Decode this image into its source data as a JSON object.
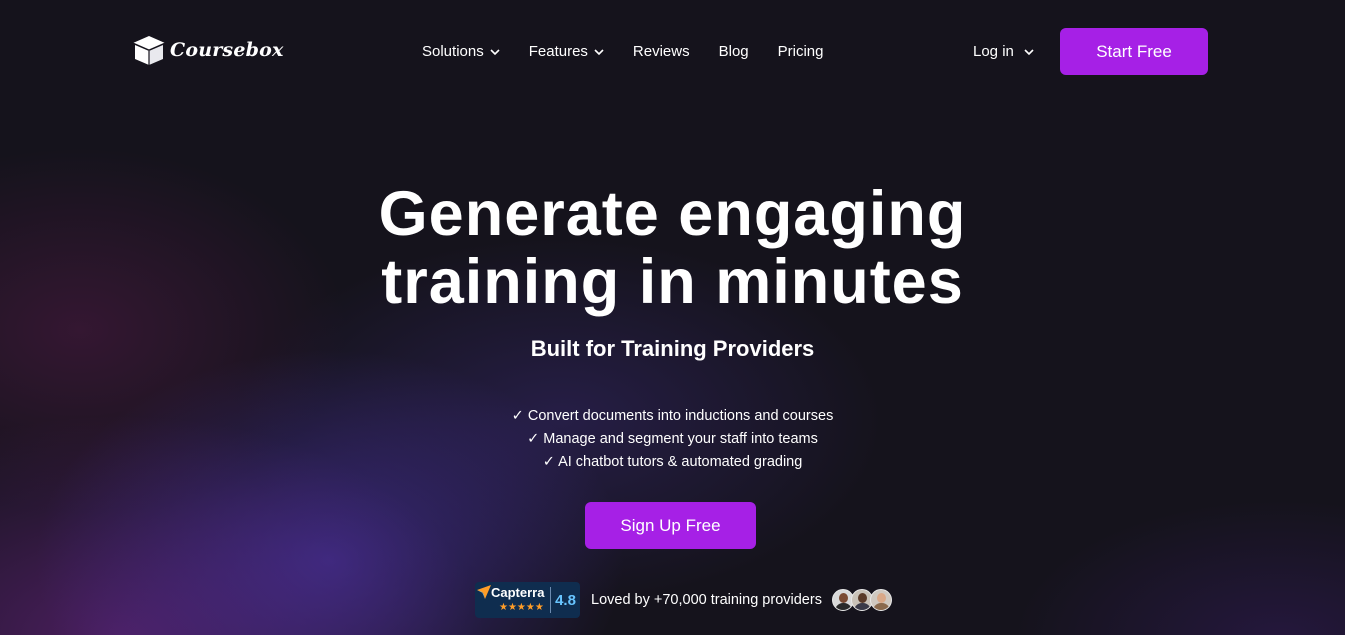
{
  "brand": {
    "name": "Coursebox",
    "logo_icon": "graduation-box-icon"
  },
  "nav": {
    "links": [
      {
        "label": "Solutions",
        "has_dropdown": true
      },
      {
        "label": "Features",
        "has_dropdown": true
      },
      {
        "label": "Reviews",
        "has_dropdown": false
      },
      {
        "label": "Blog",
        "has_dropdown": false
      },
      {
        "label": "Pricing",
        "has_dropdown": false
      }
    ],
    "login_label": "Log in",
    "start_label": "Start Free"
  },
  "hero": {
    "title_line1": "Generate engaging",
    "title_line2": "training in minutes",
    "subtitle": "Built for Training Providers",
    "checks": [
      "✓ Convert documents into inductions and courses",
      "✓ Manage and segment your staff into teams",
      "✓ AI chatbot tutors & automated grading"
    ],
    "cta_label": "Sign Up Free"
  },
  "proof": {
    "capterra_name": "Capterra",
    "capterra_stars": "★★★★★",
    "capterra_rating": "4.8",
    "loved_text": "Loved by +70,000 training providers"
  },
  "colors": {
    "accent": "#a620e6",
    "background": "#15131c",
    "capterra_bg": "#0f2d4f",
    "capterra_rating": "#68c5ff",
    "star": "#ff9d28"
  }
}
